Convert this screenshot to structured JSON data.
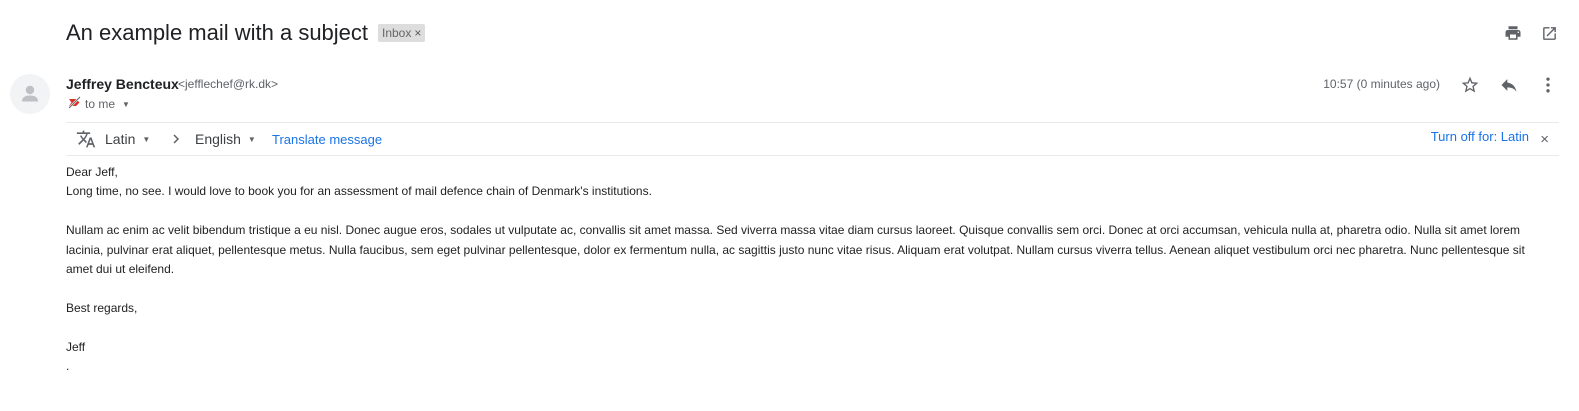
{
  "header": {
    "subject": "An example mail with a subject",
    "label_chip": "Inbox",
    "label_close": "×",
    "icons": [
      "print-icon",
      "open-in-new-window-icon"
    ]
  },
  "message": {
    "sender_name": "Jeffrey Bencteux",
    "sender_email": "<jefflechef@rk.dk>",
    "recipient": "to me",
    "timestamp": "10:57 (0 minutes ago)",
    "actions": [
      "star-icon",
      "reply-icon",
      "more-options-icon"
    ]
  },
  "translate_bar": {
    "source_language": "Latin",
    "target_language": "English",
    "translate_label": "Translate message",
    "turn_off_label": "Turn off for: Latin",
    "close": "×"
  },
  "body": {
    "greeting": "Dear Jeff,",
    "line1": "Long time, no see. I would love to book you for an assessment of mail defence chain of Denmark's institutions.",
    "paragraph": "Nullam ac enim ac velit bibendum tristique a eu nisl. Donec augue eros, sodales ut vulputate ac, convallis sit amet massa. Sed viverra massa vitae diam cursus laoreet. Quisque convallis sem orci. Donec at orci accumsan, vehicula nulla at, pharetra odio. Nulla sit amet lorem lacinia, pulvinar erat aliquet, pellentesque metus. Nulla faucibus, sem eget pulvinar pellentesque, dolor ex fermentum nulla, ac sagittis justo nunc vitae risus. Aliquam erat volutpat. Nullam cursus viverra tellus. Aenean aliquet vestibulum orci nec pharetra. Nunc pellentesque sit amet dui ut eleifend.",
    "closing": "Best regards,",
    "signature": "Jeff",
    "trailing": "."
  },
  "colors": {
    "link": "#1a73e8",
    "chip_bg": "#dddddd",
    "important_marker": "#d93025"
  }
}
